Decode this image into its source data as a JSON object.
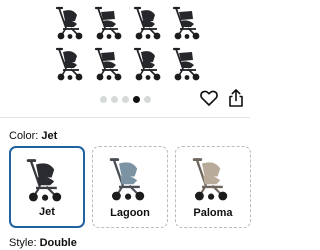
{
  "gallery": {
    "image_description": "product-image-stroller-configurations",
    "dot_count": 5,
    "active_dot_index": 3
  },
  "actions": {
    "favorite_icon": "heart-icon",
    "share_icon": "share-icon"
  },
  "color": {
    "label": "Color:",
    "value": "Jet"
  },
  "swatches": [
    {
      "label": "Jet",
      "frame": "#3a3c40",
      "seat": "#2b2c30",
      "selected": true
    },
    {
      "label": "Lagoon",
      "frame": "#4a4f55",
      "seat": "#7b93a3",
      "selected": false
    },
    {
      "label": "Paloma",
      "frame": "#6e655c",
      "seat": "#b9ab99",
      "selected": false
    }
  ],
  "style": {
    "label": "Style:",
    "value": "Double"
  },
  "colors": {
    "selected_border": "#2162a1",
    "dot_active": "#0f1111",
    "dot_inactive": "#d5d9d9"
  }
}
